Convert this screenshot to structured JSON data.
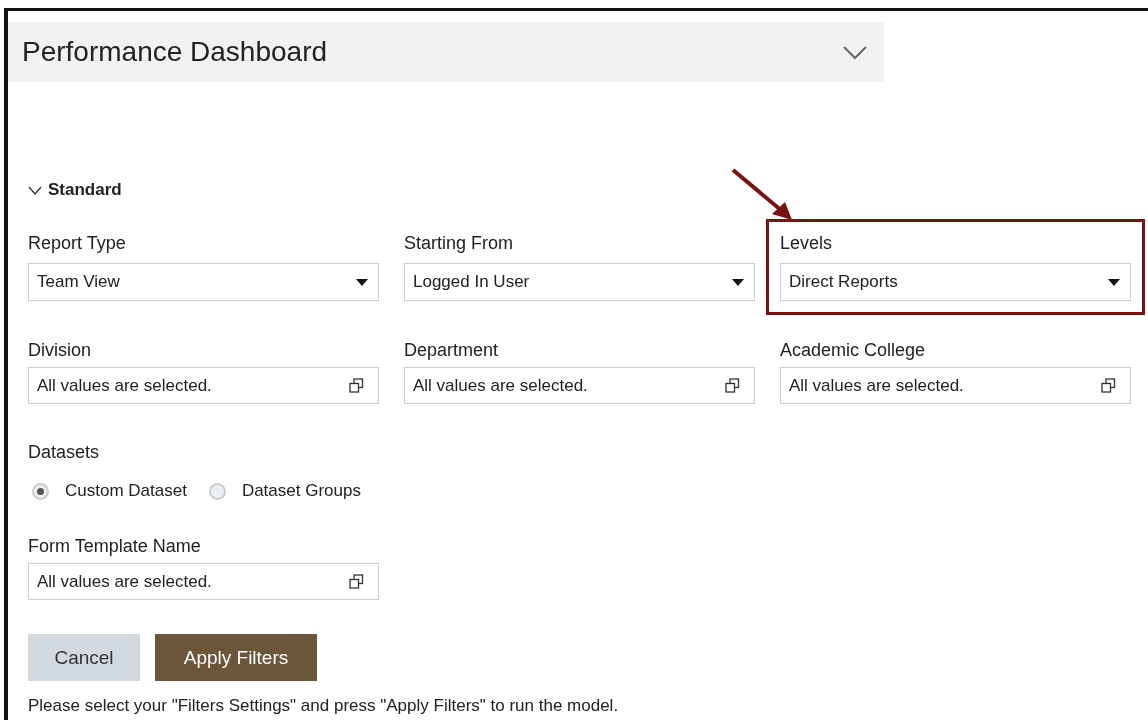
{
  "header": {
    "title": "Performance Dashboard",
    "expanded": false
  },
  "section": {
    "title": "Standard",
    "expanded": true
  },
  "filters": [
    {
      "label": "Report Type",
      "kind": "select",
      "value": "Team View",
      "highlighted": false
    },
    {
      "label": "Starting From",
      "kind": "select",
      "value": "Logged In User",
      "highlighted": false
    },
    {
      "label": "Levels",
      "kind": "select",
      "value": "Direct Reports",
      "highlighted": true
    },
    {
      "label": "Division",
      "kind": "multi",
      "value": "All values are selected.",
      "highlighted": false
    },
    {
      "label": "Department",
      "kind": "multi",
      "value": "All values are selected.",
      "highlighted": false
    },
    {
      "label": "Academic College",
      "kind": "multi",
      "value": "All values are selected.",
      "highlighted": false
    }
  ],
  "datasets": {
    "label": "Datasets",
    "options": [
      {
        "label": "Custom Dataset",
        "selected": true
      },
      {
        "label": "Dataset Groups",
        "selected": false
      }
    ]
  },
  "form_template": {
    "label": "Form Template Name",
    "kind": "multi",
    "value": "All values are selected."
  },
  "buttons": [
    {
      "label": "Cancel",
      "kind": "secondary"
    },
    {
      "label": "Apply Filters",
      "kind": "primary"
    }
  ],
  "message": "Please select your \"Filters Settings\" and press \"Apply Filters\" to run the model."
}
